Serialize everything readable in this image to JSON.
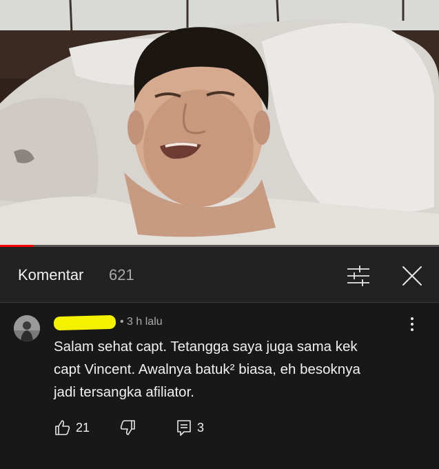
{
  "video": {
    "progress": 0.075,
    "accent_color": "#ff0000"
  },
  "comments_panel": {
    "title": "Komentar",
    "count": "621",
    "sort_icon": "sort-filter-icon",
    "close_icon": "close-icon"
  },
  "comment": {
    "time": "• 3 h lalu",
    "text": "Salam sehat capt. Tetangga saya juga sama kek\ncapt Vincent. Awalnya batuk² biasa, eh besoknya\njadi tersangka afiliator.",
    "likes": "21",
    "replies": "3",
    "highlight_color": "#f5f200",
    "icons": {
      "like": "thumbs-up-icon",
      "dislike": "thumbs-down-icon",
      "reply": "reply-icon",
      "more": "more-vertical-icon"
    }
  }
}
